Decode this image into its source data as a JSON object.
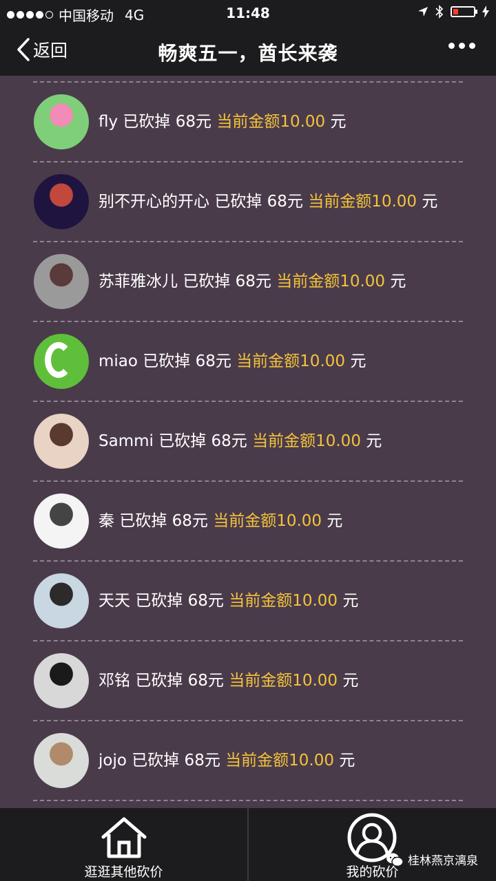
{
  "status_bar": {
    "carrier": "中国移动",
    "network": "4G",
    "time": "11:48"
  },
  "nav": {
    "back_label": "返回",
    "title": "畅爽五一，酋长来袭"
  },
  "list": {
    "action_text": "已砍掉 68元",
    "amount_text": "当前金额10.00",
    "unit": "元",
    "items": [
      {
        "name": "fly",
        "avatar_colors": [
          "#7fcf7a",
          "#f28bb5"
        ]
      },
      {
        "name": "别不开心的开心",
        "avatar_colors": [
          "#1f1440",
          "#c2473c"
        ]
      },
      {
        "name": "苏菲雅冰儿",
        "avatar_colors": [
          "#9a9a9a",
          "#5a3a3a"
        ]
      },
      {
        "name": "miao",
        "avatar_colors": [
          "#5fbf3a",
          "#ffffff"
        ]
      },
      {
        "name": "Sammi",
        "avatar_colors": [
          "#e8d3c4",
          "#5a3a2c"
        ]
      },
      {
        "name": "秦",
        "avatar_colors": [
          "#f4f4f4",
          "#444444"
        ]
      },
      {
        "name": "天天",
        "avatar_colors": [
          "#c9d7e3",
          "#2c2a2a"
        ]
      },
      {
        "name": "邓铭",
        "avatar_colors": [
          "#d8d8d8",
          "#1a1a1a"
        ]
      },
      {
        "name": "jojo",
        "avatar_colors": [
          "#d9dcd8",
          "#b08a6a"
        ]
      }
    ]
  },
  "tabbar": {
    "tabs": [
      {
        "label": "逛逛其他砍价",
        "icon": "home-icon"
      },
      {
        "label": "我的砍价",
        "icon": "user-icon"
      }
    ]
  },
  "watermark": {
    "text": "桂林燕京漓泉"
  },
  "colors": {
    "bg": "#4a3b4b",
    "bar": "#1c1c1e",
    "accent": "#f4c33a"
  }
}
